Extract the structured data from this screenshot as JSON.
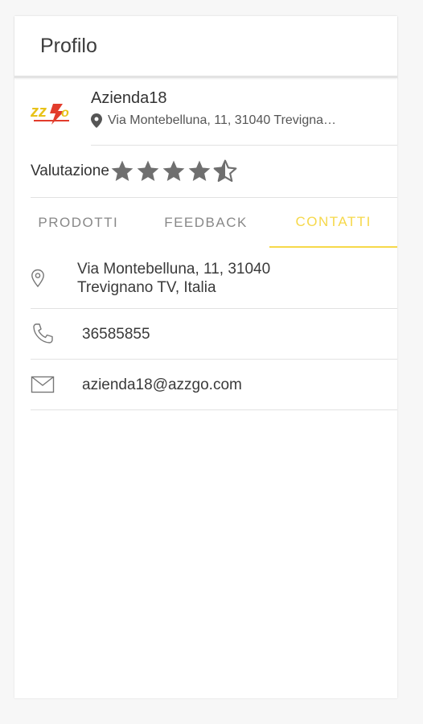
{
  "header": {
    "title": "Profilo"
  },
  "company": {
    "name": "Azienda18",
    "address": "Via Montebelluna, 11, 31040 Trevigna…",
    "logo_text": "AZZGO"
  },
  "rating": {
    "label": "Valutazione",
    "value": 4.5,
    "max": 5,
    "star_color": "#6f6f6f"
  },
  "tabs": [
    {
      "label": "PRODOTTI",
      "active": false
    },
    {
      "label": "FEEDBACK",
      "active": false
    },
    {
      "label": "CONTATTI",
      "active": true
    }
  ],
  "accent_color": "#f6d84a",
  "contacts": {
    "address_line1": "Via Montebelluna, 11, 31040",
    "address_line2": "Trevignano TV, Italia",
    "phone": "36585855",
    "email": "azienda18@azzgo.com"
  }
}
